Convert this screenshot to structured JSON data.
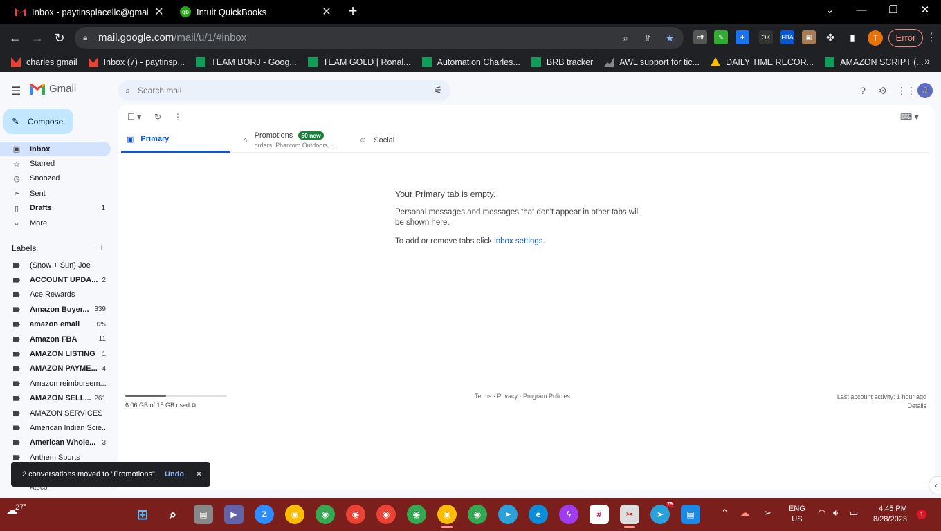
{
  "browser": {
    "tabs": [
      {
        "title": "Inbox - paytinsplacellc@gmail.co",
        "active": true
      },
      {
        "title": "Intuit QuickBooks",
        "active": false
      }
    ],
    "url_host": "mail.google.com",
    "url_path": "/mail/u/1/#inbox",
    "profile_initial": "T",
    "error_label": "Error",
    "bookmarks": [
      "charles gmail",
      "Inbox (7) - paytinsp...",
      "TEAM BORJ - Goog...",
      "TEAM GOLD | Ronal...",
      "Automation Charles...",
      "BRB tracker",
      "AWL support for tic...",
      "DAILY TIME RECOR...",
      "AMAZON SCRIPT (..."
    ],
    "bookmarks_more": "»"
  },
  "gmail": {
    "brand": "Gmail",
    "search_placeholder": "Search mail",
    "account_initial": "J",
    "compose_label": "Compose",
    "nav": [
      {
        "label": "Inbox",
        "count": "",
        "icon": "inbox-icon"
      },
      {
        "label": "Starred",
        "count": "",
        "icon": "star-icon"
      },
      {
        "label": "Snoozed",
        "count": "",
        "icon": "clock-icon"
      },
      {
        "label": "Sent",
        "count": "",
        "icon": "send-icon"
      },
      {
        "label": "Drafts",
        "count": "1",
        "icon": "draft-icon"
      },
      {
        "label": "More",
        "count": "",
        "icon": "chevron-down-icon"
      }
    ],
    "labels_header": "Labels",
    "labels": [
      {
        "name": "(Snow + Sun) Joe",
        "count": "",
        "bold": false
      },
      {
        "name": "ACCOUNT UPDA...",
        "count": "2",
        "bold": true
      },
      {
        "name": "Ace Rewards",
        "count": "",
        "bold": false
      },
      {
        "name": "Amazon Buyer...",
        "count": "339",
        "bold": true
      },
      {
        "name": "amazon email",
        "count": "325",
        "bold": true
      },
      {
        "name": "Amazon FBA",
        "count": "11",
        "bold": true
      },
      {
        "name": "AMAZON LISTING",
        "count": "1",
        "bold": true
      },
      {
        "name": "AMAZON PAYME...",
        "count": "4",
        "bold": true
      },
      {
        "name": "Amazon reimbursem...",
        "count": "",
        "bold": false
      },
      {
        "name": "AMAZON SELL...",
        "count": "261",
        "bold": true
      },
      {
        "name": "AMAZON SERVICES",
        "count": "",
        "bold": false
      },
      {
        "name": "American Indian Scie...",
        "count": "",
        "bold": false
      },
      {
        "name": "American Whole...",
        "count": "3",
        "bold": true
      },
      {
        "name": "Anthem Sports",
        "count": "",
        "bold": false
      }
    ],
    "partial_label": "Ateco",
    "tabs": {
      "primary": "Primary",
      "promotions": "Promotions",
      "promotions_badge": "50 new",
      "promotions_sub": "orders, Phantom Outdoors, ...",
      "social": "Social"
    },
    "empty": {
      "title": "Your Primary tab is empty.",
      "body": "Personal messages and messages that don't appear in other tabs will be shown here.",
      "settings_prefix": "To add or remove tabs click ",
      "settings_link": "inbox settings",
      "settings_suffix": "."
    },
    "storage": {
      "text": "6.06 GB of 15 GB used",
      "fraction": 0.404
    },
    "footer_links": "Terms · Privacy · Program Policies",
    "activity": "Last account activity: 1 hour ago",
    "details": "Details",
    "snackbar": {
      "message": "2 conversations moved to \"Promotions\".",
      "undo": "Undo"
    }
  },
  "taskbar": {
    "weather": "27°",
    "lang_top": "ENG",
    "lang_bottom": "US",
    "time": "4:45 PM",
    "date": "8/28/2023",
    "notifications": "1",
    "telegram_badge": "79"
  },
  "colors": {
    "accent": "#0b57d0",
    "compose": "#c2e7ff",
    "taskbar": "#7a1f1c"
  }
}
